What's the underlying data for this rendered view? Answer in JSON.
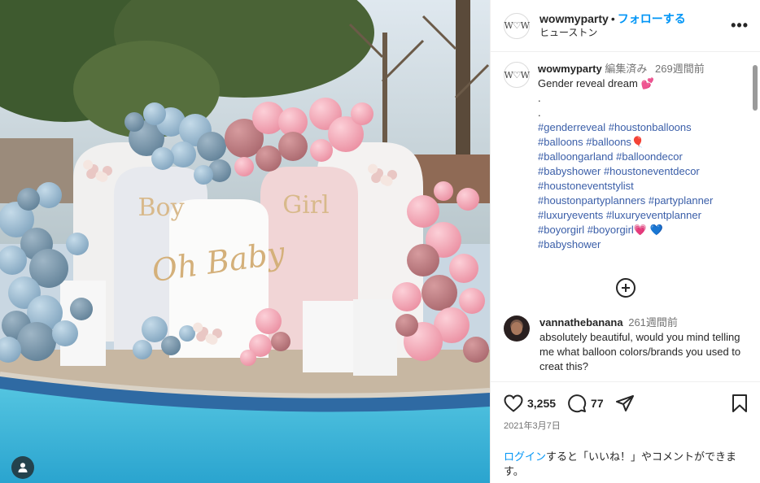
{
  "post": {
    "username": "wowmyparty",
    "follow_label": "フォローする",
    "location": "ヒューストン",
    "avatar_text": "W♡W"
  },
  "caption": {
    "username": "wowmyparty",
    "edited": "編集済み",
    "time": "269週間前",
    "line1": "Gender reveal dream 💕",
    "dot1": ".",
    "dot2": ".",
    "hashtag_lines": [
      "#genderreveal #houstonballoons",
      "#balloons #balloons🎈",
      "#balloongarland #balloondecor",
      "#babyshower #houstoneventdecor",
      "#houstoneventstylist",
      "#houstonpartyplanners #partyplanner",
      "#luxuryevents #luxuryeventplanner",
      "#boyorgirl #boyorgirl💗 💙",
      "#babyshower"
    ]
  },
  "comment": {
    "username": "vannathebanana",
    "time": "261週間前",
    "text": "absolutely beautiful, would you mind telling me what balloon colors/brands you used to creat this?"
  },
  "actions": {
    "likes": "3,255",
    "comments": "77",
    "date": "2021年3月7日"
  },
  "login_prompt": {
    "link": "ログイン",
    "rest": "すると「いいね！」やコメントができます。"
  },
  "photo": {
    "sign_boy": "Boy",
    "sign_girl": "Girl",
    "sign_center": "Oh Baby"
  },
  "colors": {
    "accent": "#0095f6",
    "hashtag": "#3a5ea8",
    "balloon_blue": "#8fb3cc",
    "balloon_pink": "#f2a5b3",
    "pool": "#3fb9d9"
  }
}
